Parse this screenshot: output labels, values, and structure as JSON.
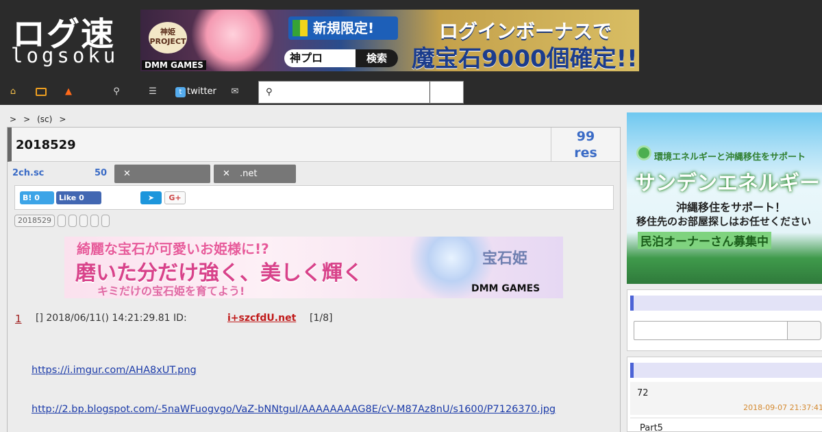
{
  "logo": {
    "jp": "ログ速",
    "en": "logsoku"
  },
  "top_banner": {
    "tl": "神姫 PROJECT",
    "dmm": "DMM GAMES",
    "badge": "新規限定!",
    "search_text": "神プロ",
    "search_btn": "検索",
    "headline1": "ログインボーナスで",
    "headline2": "魔宝石9000個確定!!"
  },
  "nav": {
    "twitter_label": "twitter",
    "search_placeholder": ""
  },
  "breadcrumb": [
    ">",
    ">",
    "(sc)",
    ">"
  ],
  "thread": {
    "title": "2018529",
    "res_count": "99",
    "res_label": "res",
    "board": "2ch.sc",
    "count": "50",
    "tag1_label": "",
    "tag2_label": ".net",
    "hatena_label": "B! 0",
    "fb_label": "Like 0",
    "tag_chip": "2018529"
  },
  "mid_banner": {
    "l1": "綺麗な宝石が可愛いお姫様に!?",
    "l2": "磨いた分だけ強く、美しく輝く",
    "l3": "キミだけの宝石姫を育てよう!",
    "logo": "宝石姫",
    "dmm": "DMM GAMES"
  },
  "post": {
    "num": "1",
    "meta": "[] 2018/06/11() 14:21:29.81 ID:",
    "uid": "i+szcfdU.net",
    "cnt": "[1/8]",
    "link1": "https://i.imgur.com/AHA8xUT.png",
    "link2": "http://2.bp.blogspot.com/-5naWFuogvgo/VaZ-bNNtguI/AAAAAAAAG8E/cV-M87Az8nU/s1600/P7126370.jpg"
  },
  "side_ad": {
    "line1": "環境エネルギーと沖縄移住をサポート",
    "line2": "サンデンエネルギー",
    "line3": "沖縄移住をサポート！",
    "line4": "移住先のお部屋探しはお任せください",
    "line5": "民泊オーナーさん募集中"
  },
  "side_list": [
    {
      "title": "72",
      "date": "2018-09-07 21:37:41"
    },
    {
      "title": "Part5",
      "date": ""
    }
  ]
}
